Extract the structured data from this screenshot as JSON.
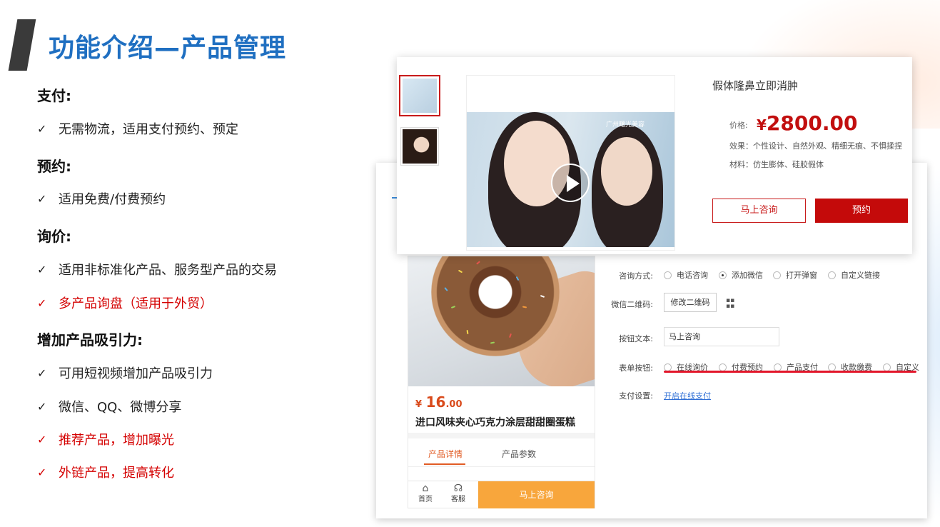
{
  "title": "功能介绍—产品管理",
  "features": [
    {
      "heading": "支付:",
      "items": [
        {
          "text": "无需物流，适用支付预约、预定",
          "highlight": false
        }
      ]
    },
    {
      "heading": "预约:",
      "items": [
        {
          "text": "适用免费/付费预约",
          "highlight": false
        }
      ]
    },
    {
      "heading": "询价:",
      "items": [
        {
          "text": "适用非标准化产品、服务型产品的交易",
          "highlight": false
        },
        {
          "text": "多产品询盘（适用于外贸）",
          "highlight": true
        }
      ]
    },
    {
      "heading": "增加产品吸引力:",
      "items": [
        {
          "text": "可用短视频增加产品吸引力",
          "highlight": false
        },
        {
          "text": "微信、QQ、微博分享",
          "highlight": false
        },
        {
          "text": "推荐产品，增加曝光",
          "highlight": true
        },
        {
          "text": "外链产品，提高转化",
          "highlight": true
        }
      ]
    }
  ],
  "check_mark": "✓",
  "product_detail": {
    "name": "假体隆鼻立即消肿",
    "price_label": "价格:",
    "currency": "¥",
    "price": "2800.00",
    "effect": "效果：个性设计、自然外观、精细无痕、不惧揉捏",
    "material": "材料：仿生膨体、硅胶假体",
    "consult_button": "马上咨询",
    "book_button": "预约",
    "video_watermark": "广州曙光美容"
  },
  "mobile_preview": {
    "currency": "¥",
    "price_int": "16",
    "price_dec": ".00",
    "product_name": "进口风味夹心巧克力涂层甜甜圈蛋糕",
    "tabs": [
      "产品详情",
      "产品参数"
    ],
    "home_label": "首页",
    "service_label": "客服",
    "consult_button": "马上咨询",
    "home_icon": "home-icon",
    "service_icon": "headset-icon"
  },
  "settings": {
    "consult_method_label": "咨询方式:",
    "consult_methods": [
      {
        "label": "电话咨询",
        "checked": false
      },
      {
        "label": "添加微信",
        "checked": true
      },
      {
        "label": "打开弹窗",
        "checked": false
      },
      {
        "label": "自定义链接",
        "checked": false
      }
    ],
    "wechat_qr_label": "微信二维码:",
    "modify_qr_button": "修改二维码",
    "button_text_label": "按钮文本:",
    "button_text_value": "马上咨询",
    "form_button_label": "表单按钮:",
    "form_buttons": [
      {
        "label": "在线询价",
        "checked": false
      },
      {
        "label": "付费预约",
        "checked": false
      },
      {
        "label": "产品支付",
        "checked": false
      },
      {
        "label": "收款缴费",
        "checked": false
      },
      {
        "label": "自定义",
        "checked": false
      }
    ],
    "payment_label": "支付设置:",
    "payment_link": "开启在线支付"
  },
  "colors": {
    "title_blue": "#1f6fc1",
    "highlight_red": "#d40000",
    "price_red": "#c20f0f",
    "mobile_orange": "#f8a63c"
  }
}
